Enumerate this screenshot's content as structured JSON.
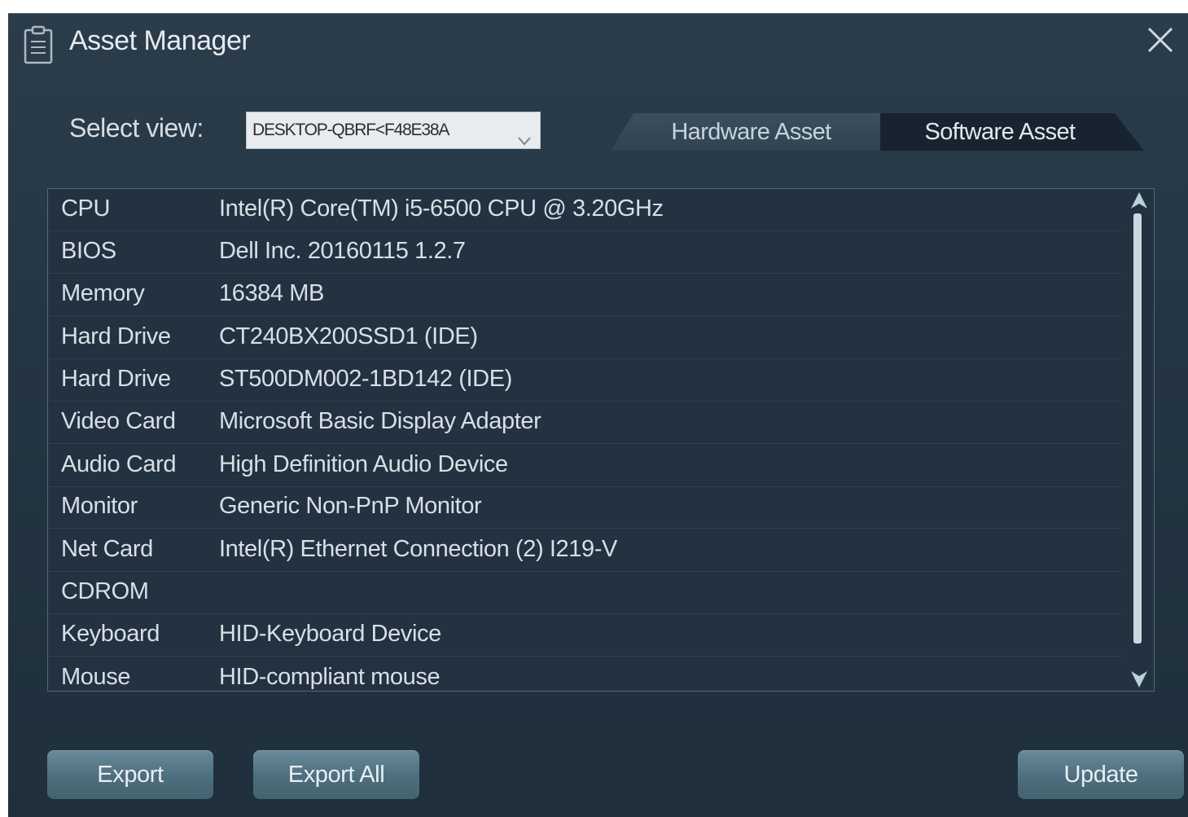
{
  "window": {
    "title": "Asset Manager",
    "app_icon": "clipboard-icon",
    "close_icon": "close-icon"
  },
  "toolbar": {
    "select_label": "Select view:",
    "select_value": "DESKTOP-QBRF<F48E38A",
    "select_icon": "chevron-down-icon"
  },
  "tabs": [
    {
      "label": "Hardware Asset",
      "active": false
    },
    {
      "label": "Software Asset",
      "active": true
    }
  ],
  "assets": [
    {
      "key": "CPU",
      "value": "Intel(R) Core(TM) i5-6500 CPU @ 3.20GHz"
    },
    {
      "key": "BIOS",
      "value": "Dell Inc. 20160115 1.2.7"
    },
    {
      "key": "Memory",
      "value": "16384 MB"
    },
    {
      "key": "Hard Drive",
      "value": "CT240BX200SSD1 (IDE)"
    },
    {
      "key": "Hard Drive",
      "value": "ST500DM002-1BD142 (IDE)"
    },
    {
      "key": "Video Card",
      "value": "Microsoft Basic Display Adapter"
    },
    {
      "key": "Audio Card",
      "value": "High Definition Audio Device"
    },
    {
      "key": "Monitor",
      "value": "Generic Non-PnP Monitor"
    },
    {
      "key": "Net Card",
      "value": "Intel(R) Ethernet Connection (2) I219-V"
    },
    {
      "key": "CDROM",
      "value": ""
    },
    {
      "key": "Keyboard",
      "value": "HID-Keyboard Device"
    },
    {
      "key": "Mouse",
      "value": "HID-compliant mouse"
    }
  ],
  "buttons": {
    "export": "Export",
    "export_all": "Export All",
    "update": "Update"
  },
  "colors": {
    "background": "#243543",
    "active_tab": "#17242f",
    "button": "#5a7a89"
  }
}
